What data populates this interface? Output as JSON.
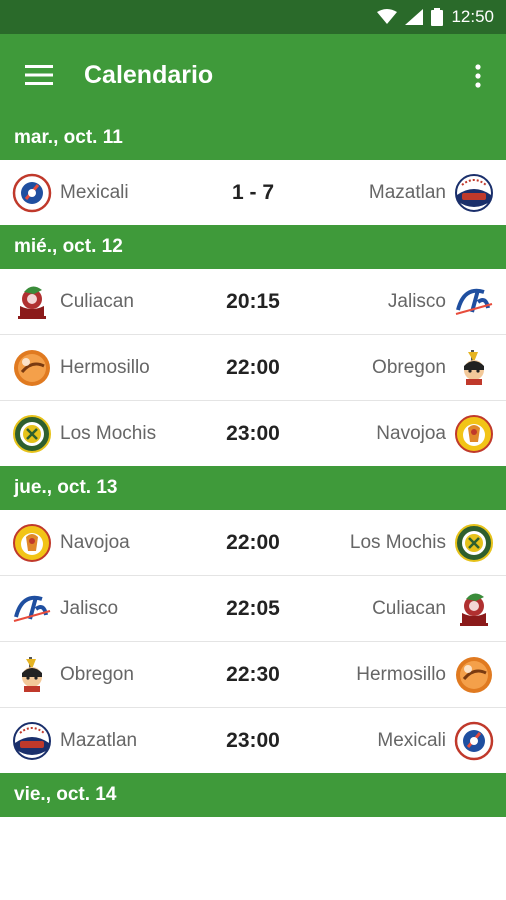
{
  "status_bar": {
    "time": "12:50"
  },
  "app_bar": {
    "title": "Calendario"
  },
  "days": [
    {
      "label": "mar., oct. 11",
      "games": [
        {
          "home": "Mexicali",
          "home_logo": "mexicali",
          "result": "1 - 7",
          "away": "Mazatlan",
          "away_logo": "mazatlan"
        }
      ]
    },
    {
      "label": "mié., oct. 12",
      "games": [
        {
          "home": "Culiacan",
          "home_logo": "culiacan",
          "result": "20:15",
          "away": "Jalisco",
          "away_logo": "jalisco"
        },
        {
          "home": "Hermosillo",
          "home_logo": "hermosillo",
          "result": "22:00",
          "away": "Obregon",
          "away_logo": "obregon"
        },
        {
          "home": "Los Mochis",
          "home_logo": "mochis",
          "result": "23:00",
          "away": "Navojoa",
          "away_logo": "navojoa"
        }
      ]
    },
    {
      "label": "jue., oct. 13",
      "games": [
        {
          "home": "Navojoa",
          "home_logo": "navojoa",
          "result": "22:00",
          "away": "Los Mochis",
          "away_logo": "mochis"
        },
        {
          "home": "Jalisco",
          "home_logo": "jalisco",
          "result": "22:05",
          "away": "Culiacan",
          "away_logo": "culiacan"
        },
        {
          "home": "Obregon",
          "home_logo": "obregon",
          "result": "22:30",
          "away": "Hermosillo",
          "away_logo": "hermosillo"
        },
        {
          "home": "Mazatlan",
          "home_logo": "mazatlan",
          "result": "23:00",
          "away": "Mexicali",
          "away_logo": "mexicali"
        }
      ]
    },
    {
      "label": "vie., oct. 14",
      "games": []
    }
  ]
}
